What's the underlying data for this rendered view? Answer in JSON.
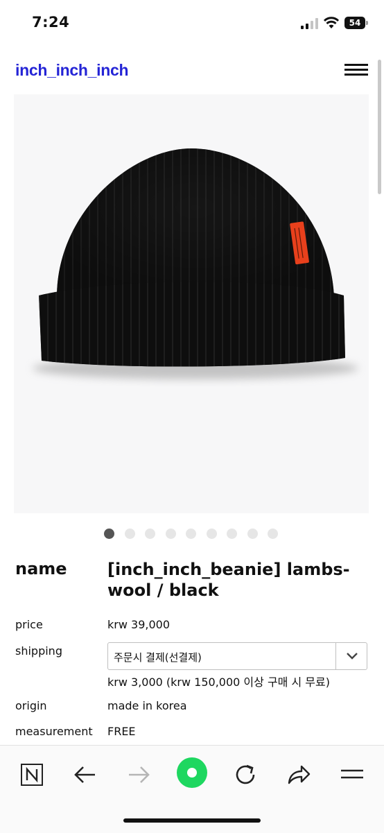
{
  "status_bar": {
    "time": "7:24",
    "battery": "54"
  },
  "header": {
    "logo": "inch_inch_inch"
  },
  "carousel": {
    "total": 9,
    "active": 0
  },
  "product": {
    "name_label": "name",
    "name_line1": "[inch_inch_beanie] lambs-",
    "name_line2": "wool / black",
    "price_label": "price",
    "price_value": "krw 39,000",
    "shipping_label": "shipping",
    "shipping_selected": "주문시 결제(선결제)",
    "shipping_note": "krw 3,000 (krw 150,000 이상 구매 시 무료)",
    "origin_label": "origin",
    "origin_value": "made in korea",
    "measurement_label": "measurement",
    "measurement_value": "FREE"
  },
  "colors": {
    "logo": "#2424d6",
    "beanie": "#0d0d0d",
    "tag": "#e8401c",
    "browser_accent": "#1ed760"
  },
  "toolbar_icons": [
    "naver-icon",
    "back-icon",
    "forward-icon",
    "green-dot-icon",
    "reload-icon",
    "share-icon",
    "menu-icon"
  ]
}
